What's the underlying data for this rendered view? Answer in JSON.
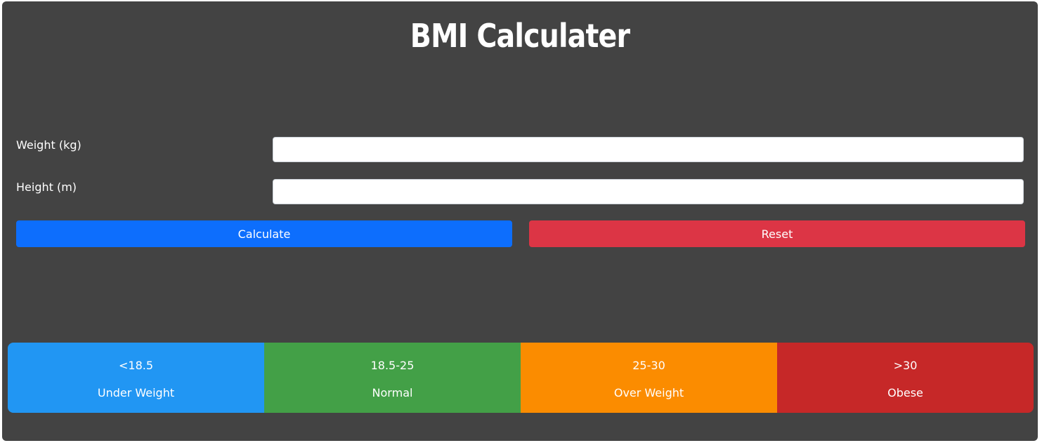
{
  "app": {
    "title": "BMI Calculater"
  },
  "form": {
    "weight_label": "Weight (kg)",
    "weight_value": "",
    "height_label": "Height (m)",
    "height_value": "",
    "calculate_label": "Calculate",
    "reset_label": "Reset"
  },
  "scale": [
    {
      "range": "<18.5",
      "category": "Under Weight",
      "color": "#2196f3"
    },
    {
      "range": "18.5-25",
      "category": "Normal",
      "color": "#43a047"
    },
    {
      "range": "25-30",
      "category": "Over Weight",
      "color": "#fb8c00"
    },
    {
      "range": ">30",
      "category": "Obese",
      "color": "#c62828"
    }
  ],
  "colors": {
    "background": "#434343",
    "calculate_button": "#0d6efd",
    "reset_button": "#dc3545"
  }
}
